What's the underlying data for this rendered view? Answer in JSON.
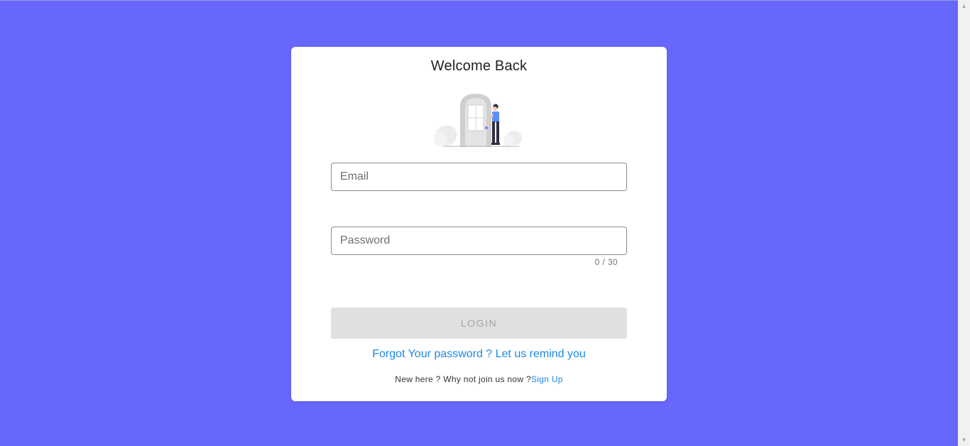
{
  "login": {
    "title": "Welcome Back",
    "email_placeholder": "Email",
    "password_placeholder": "Password",
    "password_counter": "0 / 30",
    "login_label": "LOGIN",
    "forgot_text": "Forgot Your password ? Let us remind you",
    "signup_prompt": "New here ? Why not join us now ?",
    "signup_link": "Sign Up"
  },
  "colors": {
    "background": "#6767fe",
    "card": "#ffffff",
    "link": "#1e88e5",
    "button_disabled": "#e0e0e0"
  },
  "icons": {
    "illustration": "person-at-door-illustration",
    "scroll_up": "scroll-up-arrow-icon",
    "scroll_down": "scroll-down-arrow-icon"
  }
}
